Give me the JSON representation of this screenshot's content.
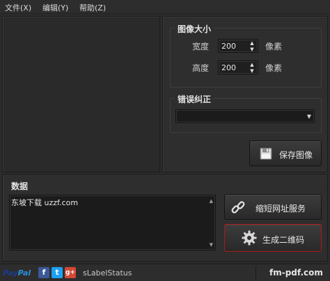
{
  "menu": {
    "file": "文件(X)",
    "edit": "编辑(Y)",
    "help": "帮助(Z)"
  },
  "image_size": {
    "title": "图像大小",
    "width_label": "宽度",
    "width_value": "200",
    "height_label": "高度",
    "height_value": "200",
    "unit": "像素"
  },
  "error_correction": {
    "title": "错误纠正",
    "selected": ""
  },
  "buttons": {
    "save_image": "保存图像",
    "shorten_url": "缩短网址服务",
    "generate_qr": "生成二维码"
  },
  "data_section": {
    "title": "数据",
    "text": "东坡下载 uzzf.com"
  },
  "status": {
    "paypal_pay": "Pay",
    "paypal_pal": "Pal",
    "facebook": "f",
    "twitter": "t",
    "googleplus": "g+",
    "label": "sLabelStatus",
    "site": "fm-pdf.com"
  },
  "colors": {
    "accent_red": "#b01818",
    "facebook": "#3b5998",
    "twitter": "#1da1f2",
    "googleplus": "#d34836",
    "paypal_dark": "#1a3e8c",
    "paypal_light": "#2a8fd8"
  },
  "icons": [
    "floppy-disk-icon",
    "chain-link-icon",
    "gear-icon",
    "spin-up-icon",
    "spin-down-icon",
    "dropdown-arrow-icon"
  ]
}
